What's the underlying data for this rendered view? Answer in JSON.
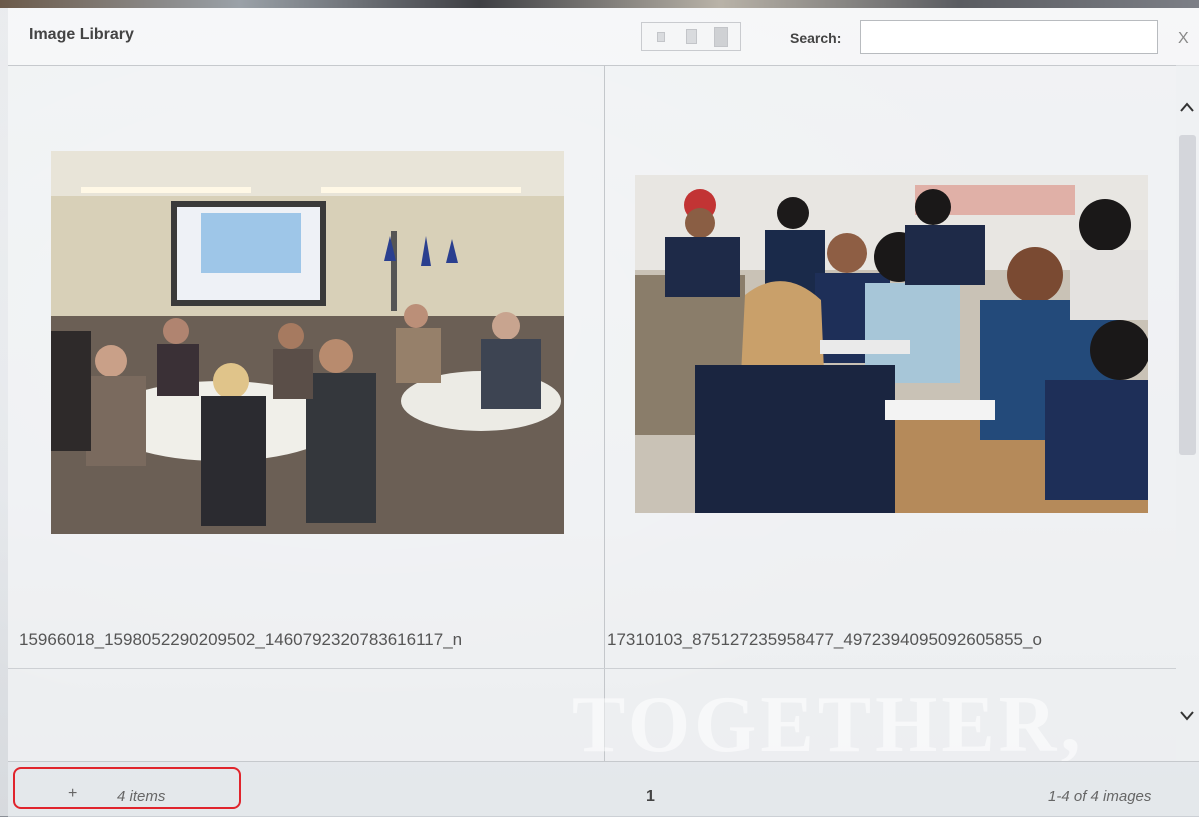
{
  "header": {
    "title": "Image Library",
    "search_label": "Search:",
    "search_value": "",
    "search_placeholder": "",
    "close_label": "X",
    "view_modes": [
      "small-thumbnails",
      "medium-thumbnails",
      "large-thumbnails"
    ]
  },
  "images": [
    {
      "filename": "15966018_1598052290209502_1460792320783616117_n",
      "kind": "conference-photo"
    },
    {
      "filename": "17310103_875127235958477_4972394095092605855_o",
      "kind": "classroom-photo"
    }
  ],
  "watermark": "TOGETHER,",
  "footer": {
    "add_label": "+",
    "item_count": "4 items",
    "page": "1",
    "range": "1-4 of 4 images"
  },
  "icons": {
    "scroll_up": "chevron-up-icon",
    "scroll_down": "chevron-down-icon",
    "close": "close-icon"
  },
  "colors": {
    "highlight": "#e0242c",
    "text": "#444444"
  }
}
